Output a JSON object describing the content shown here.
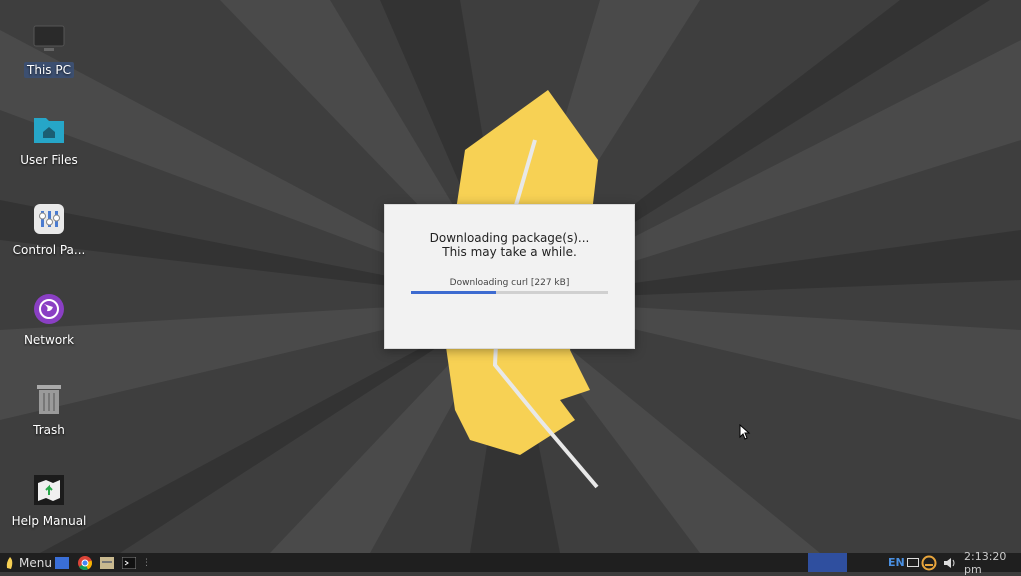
{
  "desktop": {
    "icons": [
      {
        "label": "This PC",
        "icon": "computer-icon"
      },
      {
        "label": "User Files",
        "icon": "home-folder-icon"
      },
      {
        "label": "Control Pa...",
        "icon": "control-panel-icon"
      },
      {
        "label": "Network",
        "icon": "network-icon"
      },
      {
        "label": "Trash",
        "icon": "trash-icon"
      },
      {
        "label": "Help Manual",
        "icon": "help-manual-icon"
      }
    ]
  },
  "dialog": {
    "line1": "Downloading package(s)...",
    "line2": "This may take a while.",
    "status": "Downloading curl [227 kB]",
    "progress_percent": 43,
    "accent": "#3d6bd0"
  },
  "taskbar": {
    "menu_label": "Menu",
    "lang": "EN",
    "clock": "2:13:20 pm",
    "active_task_color": "#2f4f9f"
  }
}
